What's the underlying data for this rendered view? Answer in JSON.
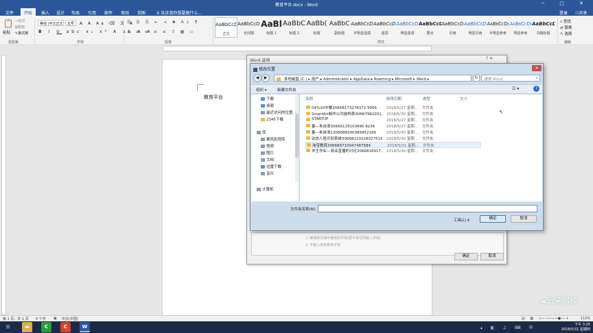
{
  "app": {
    "title": "教育平台.docx - Word",
    "controls": "─ ▢ ✕"
  },
  "menu": [
    "文件",
    "开始",
    "插入",
    "设计",
    "布局",
    "引用",
    "邮件",
    "审阅",
    "视图"
  ],
  "tell_me": "告诉我你想要做什么...",
  "user": {
    "login": "登录",
    "share": "共享"
  },
  "ribbon": {
    "clipboard": {
      "paste": "粘贴",
      "cut": "剪切",
      "copy": "复制",
      "format_painter": "格式刷",
      "label": "剪贴板"
    },
    "font": {
      "name": "等线 (中文正文)",
      "size": "五号",
      "label": "字体"
    },
    "paragraph": {
      "label": "段落"
    },
    "styles": {
      "label": "样式",
      "items": [
        {
          "sample": "AaBbCcDı",
          "name": "正文"
        },
        {
          "sample": "AaBbCcDı",
          "name": "无间隔"
        },
        {
          "sample": "AaBl",
          "name": "标题 1"
        },
        {
          "sample": "AaBbC",
          "name": "标题 2"
        },
        {
          "sample": "AaBb(",
          "name": "标题"
        },
        {
          "sample": "AaBbC",
          "name": "副标题"
        },
        {
          "sample": "AaBbCcDı",
          "name": "不明显强调"
        },
        {
          "sample": "AaBbCcDı",
          "name": "强调"
        },
        {
          "sample": "AaBbCcDı",
          "name": "明显强调"
        },
        {
          "sample": "AaBbCcDı",
          "name": "要点"
        },
        {
          "sample": "AaBbCcDı",
          "name": "引用"
        },
        {
          "sample": "AaBbCcDı",
          "name": "明显引用"
        },
        {
          "sample": "AaBbCcDı",
          "name": "不明显参考"
        },
        {
          "sample": "AaBbCcDı",
          "name": "明显参考"
        },
        {
          "sample": "AaBbCcD",
          "name": "书籍标题"
        }
      ]
    },
    "editing": {
      "find": "查找",
      "replace": "替换",
      "select": "选择",
      "label": "编辑"
    }
  },
  "document": {
    "text": "教育平台"
  },
  "options_dialog": {
    "title": "Word 选项",
    "check1": "链接到文档中使用的字体(若不存在则嵌入字体)",
    "check2": "不嵌入常用系统字体",
    "ok": "确定",
    "cancel": "取消"
  },
  "file_dialog": {
    "title": "修改位置",
    "path": [
      "本地磁盘 (C:)",
      "用户",
      "Administrator",
      "AppData",
      "Roaming",
      "Microsoft",
      "Word"
    ],
    "search_placeholder": "搜索 Word",
    "organize": "组织 ▾",
    "new_folder": "新建文件夹",
    "columns": {
      "name": "名称",
      "date": "修改日期",
      "type": "类型",
      "size": "大小"
    },
    "nav": {
      "favorites": [
        "下载",
        "桌面",
        "最近访问的位置",
        "2345下载"
      ],
      "library_header": "库",
      "libraries": [
        "暴风影视库",
        "视频",
        "图片",
        "文档",
        "迅雷下载",
        "音乐"
      ],
      "computer": "计算机"
    },
    "files": [
      {
        "name": "04%20中餐30668173278372 9956",
        "date": "2018/5/27 星期...",
        "type": "文件夹"
      },
      {
        "name": "SmartArt制作公司结构表30667962201...",
        "date": "2018/5/30 星期...",
        "type": "文件夹"
      },
      {
        "name": "STARTUP",
        "date": "2018/5/27 星期...",
        "type": "文件夹"
      },
      {
        "name": "春—朱自清30668128103690 8236",
        "date": "2018/5/27 星期...",
        "type": "文件夹"
      },
      {
        "name": "春—朱自清1306688200389952166",
        "date": "2018/5/30 星期...",
        "type": "文件夹"
      },
      {
        "name": "动态人脸识别系统306682232280275156",
        "date": "2018/5/30 星期...",
        "type": "文件夹"
      },
      {
        "name": "淘宝教育306689710947487584",
        "date": "2018/5/31 星期...",
        "type": "文件夹"
      },
      {
        "name": "学生作业—商业直播的讨论3066816917...",
        "date": "2018/5/30 星期...",
        "type": "文件夹"
      }
    ],
    "folder_name_label": "文件夹名称(N):",
    "tools": "工具(L)  ▾",
    "ok": "确定",
    "cancel": "取消"
  },
  "status": {
    "page": "第 1 页，共 1 页",
    "words": "4 个字",
    "lang": "中文(中国)",
    "zoom": "110%"
  },
  "taskbar": {
    "time": "下午 3:25",
    "date": "2018/5/31 星期四"
  },
  "watermark": "云朵网校"
}
